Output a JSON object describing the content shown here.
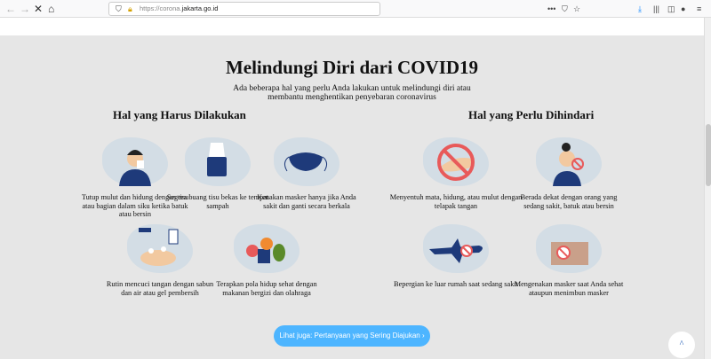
{
  "browser": {
    "url_prefix": "https://corona.",
    "url_domain": "jakarta.go.id"
  },
  "page": {
    "title": "Melindungi Diri dari COVID19",
    "subtitle": "Ada beberapa hal yang perlu Anda lakukan untuk melindungi diri atau membantu menghentikan penyebaran coronavirus",
    "do_heading": "Hal yang Harus Dilakukan",
    "dont_heading": "Hal yang Perlu Dihindari",
    "do_items": [
      {
        "icon": "cough-tissue-icon",
        "text": "Tutup mulut dan hidung dengan tisu atau bagian dalam siku ketika batuk atau bersin"
      },
      {
        "icon": "tissue-box-icon",
        "text": "Segera buang tisu bekas ke tempat sampah"
      },
      {
        "icon": "face-mask-icon",
        "text": "Kenakan masker hanya jika Anda sakit dan ganti secara berkala"
      },
      {
        "icon": "hand-wash-icon",
        "text": "Rutin mencuci tangan dengan sabun dan air atau gel pembersih"
      },
      {
        "icon": "healthy-food-icon",
        "text": "Terapkan pola hidup sehat dengan makanan bergizi dan olahraga"
      }
    ],
    "dont_items": [
      {
        "icon": "no-touch-face-icon",
        "text": "Menyentuh mata, hidung, atau mulut dengan telapak tangan"
      },
      {
        "icon": "no-close-contact-icon",
        "text": "Berada dekat dengan orang yang sedang sakit, batuk atau bersin"
      },
      {
        "icon": "no-travel-icon",
        "text": "Bepergian ke luar rumah saat sedang sakit"
      },
      {
        "icon": "no-mask-hoarding-icon",
        "text": "Mengenakan masker saat Anda sehat ataupun menimbun masker"
      }
    ],
    "faq_button": "Lihat juga: Pertanyaan yang Sering Diajukan ›",
    "colors": {
      "accent": "#4db5ff",
      "navy": "#1e3a7a",
      "prohibit": "#e85a5a",
      "blob": "#d3dde5"
    }
  }
}
